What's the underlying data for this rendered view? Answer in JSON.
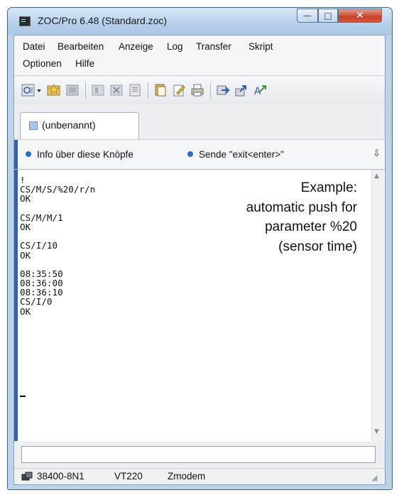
{
  "window": {
    "title": "ZOC/Pro 6.48 (Standard.zoc)",
    "controls": {
      "minimize": "—",
      "maximize": "□",
      "close": "✕"
    }
  },
  "menu": {
    "row1": [
      "Datei",
      "Bearbeiten",
      "Anzeige",
      "Log",
      "Transfer",
      "Skript"
    ],
    "row2": [
      "Optionen",
      "Hilfe"
    ]
  },
  "toolbar": {
    "icons": [
      "dial-icon",
      "dropdown-arrow-icon",
      "favorites-icon",
      "disconnect-icon",
      "record-icon",
      "clear-icon",
      "new-window-icon",
      "copy-icon",
      "edit-icon",
      "print-icon",
      "transfer-icon",
      "upload-icon",
      "script-icon"
    ]
  },
  "tab": {
    "label": "(unbenannt)"
  },
  "buttonbar": {
    "buttons": [
      "Info über diese Knöpfe",
      "Sende \"exit<enter>\""
    ],
    "overflow": "⇩"
  },
  "terminal": {
    "lines": [
      "!",
      "CS/M/S/%20/r/n",
      "OK",
      "",
      "CS/M/M/1",
      "OK",
      "",
      "CS/I/10",
      "OK",
      "",
      "08:35:50",
      "08:36:00",
      "08:36:10",
      "CS/I/0",
      "OK"
    ],
    "annotation": [
      "Example:",
      "automatic push for",
      "parameter %20",
      "(sensor time)"
    ]
  },
  "input": {
    "value": ""
  },
  "status": {
    "baud": "38400-8N1",
    "emulation": "VT220",
    "transfer": "Zmodem"
  },
  "colors": {
    "frame": "#bcd3ea",
    "accent": "#3a5fa0",
    "close": "#c8412a"
  }
}
